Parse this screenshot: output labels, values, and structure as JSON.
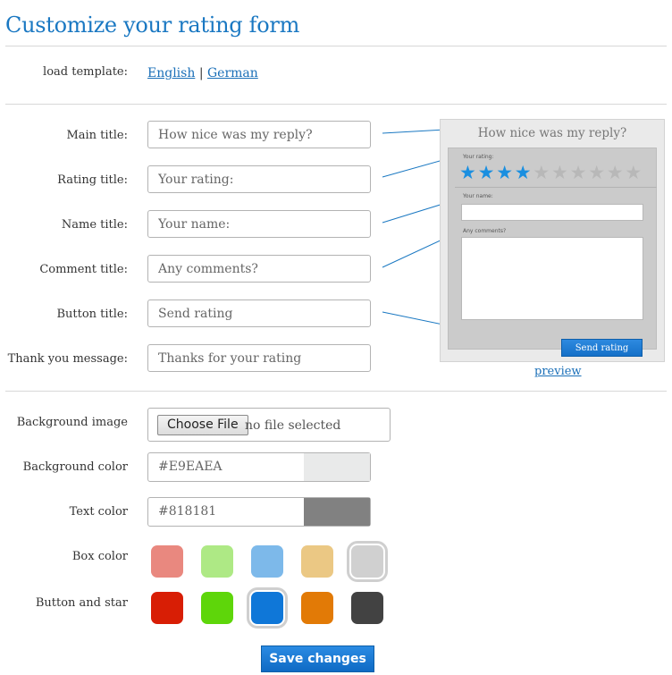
{
  "page_title": "Customize your rating form",
  "template": {
    "label": "load template:",
    "english": "English",
    "separator": "|",
    "german": "German"
  },
  "fields": [
    {
      "label": "Main title:",
      "value": "How nice was my reply?"
    },
    {
      "label": "Rating title:",
      "value": "Your rating:"
    },
    {
      "label": "Name title:",
      "value": "Your name:"
    },
    {
      "label": "Comment title:",
      "value": "Any comments?"
    },
    {
      "label": "Button title:",
      "value": "Send rating"
    },
    {
      "label": "Thank you message:",
      "value": "Thanks for your rating"
    }
  ],
  "preview": {
    "title": "How nice was my reply?",
    "rating_label": "Your rating:",
    "name_label": "Your name:",
    "comment_label": "Any comments?",
    "button_label": "Send rating",
    "stars_filled": 4,
    "stars_total": 10,
    "star_on_color": "#1a8fe0",
    "star_off_color": "#b8b8b8",
    "link": "preview"
  },
  "background_image": {
    "label": "Background image",
    "button": "Choose File",
    "status": "no file selected"
  },
  "background_color": {
    "label": "Background color",
    "value": "#E9EAEA",
    "swatch": "#e9eaea"
  },
  "text_color": {
    "label": "Text color",
    "value": "#818181",
    "swatch": "#818181"
  },
  "box_color": {
    "label": "Box color",
    "options": [
      "#e9887f",
      "#aee985",
      "#7db9ea",
      "#ebc884",
      "#d0d0d0"
    ],
    "selected": 4
  },
  "button_star": {
    "label": "Button and star",
    "options": [
      "#d81e05",
      "#5ed60a",
      "#0f77d8",
      "#e27a06",
      "#424242"
    ],
    "selected": 2
  },
  "save_label": "Save changes",
  "colors": {
    "accent": "#1a78c2",
    "link": "#1a6fb8"
  }
}
